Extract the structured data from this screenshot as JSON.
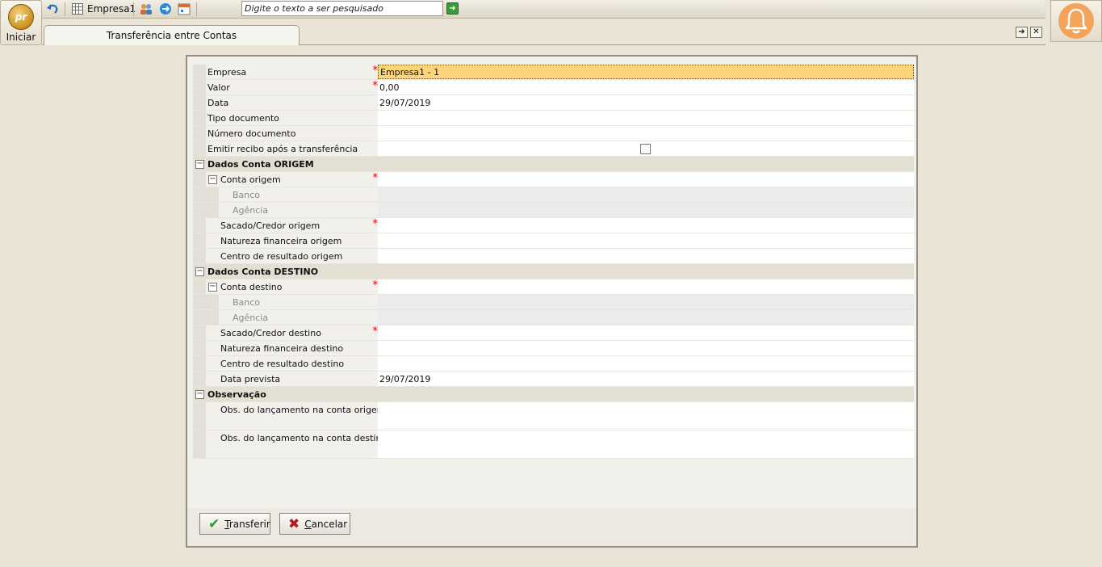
{
  "start": {
    "logo_text": "pr",
    "label": "Iniciar"
  },
  "toolbar": {
    "company": "Empresa1",
    "search_placeholder": "Digite o texto a ser pesquisado"
  },
  "tab": {
    "title": "Transferência entre Contas"
  },
  "form": {
    "empresa": {
      "label": "Empresa",
      "value": "Empresa1 - 1"
    },
    "valor": {
      "label": "Valor",
      "value": "0,00"
    },
    "data": {
      "label": "Data",
      "value": "29/07/2019"
    },
    "tipo_documento": {
      "label": "Tipo documento",
      "value": ""
    },
    "numero_documento": {
      "label": "Número documento",
      "value": ""
    },
    "emitir_recibo": {
      "label": "Emitir recibo após a transferência",
      "checked": false
    },
    "origem": {
      "section": "Dados Conta ORIGEM",
      "conta": "Conta origem",
      "banco": "Banco",
      "agencia": "Agência",
      "sacado": "Sacado/Credor origem",
      "natureza": "Natureza financeira origem",
      "centro": "Centro de resultado origem"
    },
    "destino": {
      "section": "Dados Conta DESTINO",
      "conta": "Conta destino",
      "banco": "Banco",
      "agencia": "Agência",
      "sacado": "Sacado/Credor destino",
      "natureza": "Natureza financeira destino",
      "centro": "Centro de resultado destino",
      "data_prevista": "Data prevista",
      "data_prevista_value": "29/07/2019"
    },
    "observacao": {
      "section": "Observação",
      "obs_origem": "Obs. do lançamento na conta origem",
      "obs_destino": "Obs. do lançamento na conta destino"
    }
  },
  "buttons": {
    "transferir_first": "T",
    "transferir_rest": "ransferir",
    "cancelar_first": "C",
    "cancelar_rest": "ancelar"
  },
  "colors": {
    "highlight": "#fcd57a",
    "required": "#dd0000",
    "background": "#e9e4d6"
  }
}
